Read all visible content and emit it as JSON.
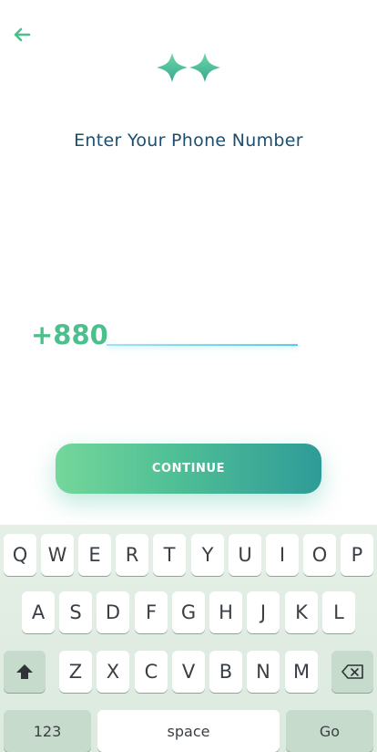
{
  "header": {
    "back_icon": "arrow-left-icon",
    "logo_icon": "sparkle-logo-icon"
  },
  "title": "Enter Your Phone Number",
  "phone": {
    "country_code": "+880",
    "value": "",
    "placeholder": ""
  },
  "continue_label": "CONTINUE",
  "keyboard": {
    "row1": [
      "Q",
      "W",
      "E",
      "R",
      "T",
      "Y",
      "U",
      "I",
      "O",
      "P"
    ],
    "row2": [
      "A",
      "S",
      "D",
      "F",
      "G",
      "H",
      "J",
      "K",
      "L"
    ],
    "row3": [
      "Z",
      "X",
      "C",
      "V",
      "B",
      "N",
      "M"
    ],
    "numbers_label": "123",
    "space_label": "space",
    "go_label": "Go",
    "shift_icon": "shift-icon",
    "backspace_icon": "backspace-icon"
  },
  "colors": {
    "accent": "#4cc08c",
    "title": "#1d4e6d",
    "button_gradient_start": "#74d79a",
    "button_gradient_end": "#2f9b98",
    "keyboard_bg": "#e5efe6"
  }
}
